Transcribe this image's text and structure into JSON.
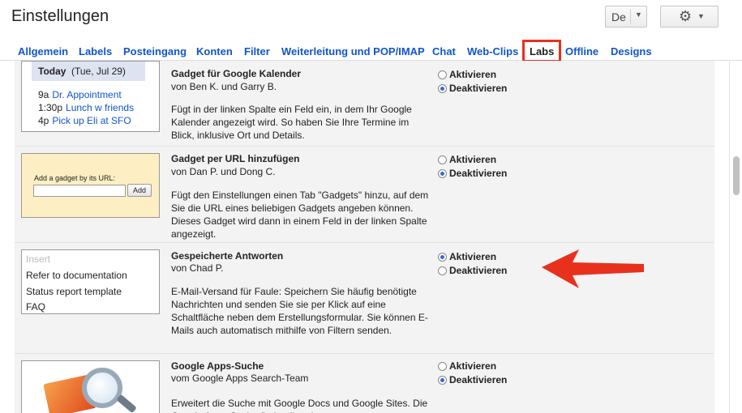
{
  "header": {
    "title": "Einstellungen",
    "language_button": "De",
    "settings_icon": "gear-icon"
  },
  "tabs": [
    {
      "label": "Allgemein",
      "active": false
    },
    {
      "label": "Labels",
      "active": false
    },
    {
      "label": "Posteingang",
      "active": false
    },
    {
      "label": "Konten",
      "active": false
    },
    {
      "label": "Filter",
      "active": false
    },
    {
      "label": "Weiterleitung und POP/IMAP",
      "active": false
    },
    {
      "label": "Chat",
      "active": false
    },
    {
      "label": "Web-Clips",
      "active": false
    },
    {
      "label": "Labs",
      "active": true
    },
    {
      "label": "Offline",
      "active": false
    },
    {
      "label": "Designs",
      "active": false
    }
  ],
  "options": {
    "enable": "Aktivieren",
    "disable": "Deaktivieren"
  },
  "gadgets": [
    {
      "title": "Gadget für Google Kalender",
      "author": "von Ben K. und Garry B.",
      "description": "Fügt in der linken Spalte ein Feld ein, in dem Ihr Google Kalender angezeigt wird. So haben Sie Ihre Termine im Blick, inklusive Ort und Details.",
      "selected": "Deaktivieren",
      "preview": {
        "day": "Today",
        "date": "(Tue, Jul 29)",
        "events": [
          {
            "time": "9a",
            "text": "Dr. Appointment"
          },
          {
            "time": "1:30p",
            "text": "Lunch w friends"
          },
          {
            "time": "4p",
            "text": "Pick up Eli at SFO"
          }
        ]
      }
    },
    {
      "title": "Gadget per URL hinzufügen",
      "author": "von Dan P. und Dong C.",
      "description": "Fügt den Einstellungen einen Tab \"Gadgets\" hinzu, auf dem Sie die URL eines beliebigen Gadgets angeben können. Dieses Gadget wird dann in einem Feld in der linken Spalte angezeigt.",
      "selected": "Deaktivieren",
      "preview": {
        "label": "Add a gadget by its URL:",
        "button": "Add"
      }
    },
    {
      "title": "Gespeicherte Antworten",
      "author": "von Chad P.",
      "description": "E-Mail-Versand für Faule: Speichern Sie häufig benötigte Nachrichten und senden Sie sie per Klick auf eine Schaltfläche neben dem Erstellungsformular. Sie können E-Mails auch automatisch mithilfe von Filtern senden.",
      "selected": "Aktivieren",
      "preview": {
        "items": [
          "Insert",
          "Refer to documentation",
          "Status report template",
          "FAQ"
        ]
      }
    },
    {
      "title": "Google Apps-Suche",
      "author": "vom Google Apps Search-Team",
      "description": "Erweitert die Suche mit Google Docs und Google Sites. Die Google Apps-Suche findet die relevantesten",
      "selected": "Deaktivieren"
    }
  ],
  "annotation": {
    "color": "#e8311c"
  }
}
